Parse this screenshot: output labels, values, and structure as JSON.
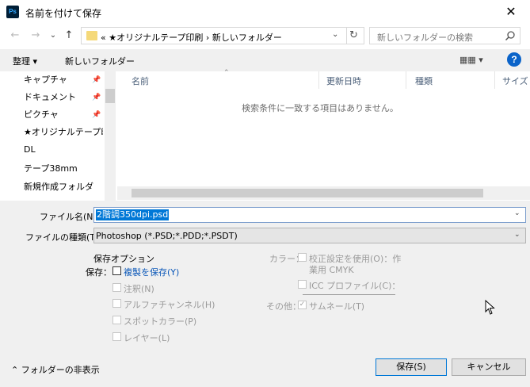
{
  "window": {
    "title": "名前を付けて保存",
    "app_icon": "Ps",
    "close_glyph": "✕"
  },
  "nav": {
    "back": "←",
    "forward": "→",
    "recent": "⌄",
    "up": "↑"
  },
  "address": {
    "path": "«  ★オリジナルテープ印刷  ›  新しいフォルダー",
    "dropdown": "⌄",
    "refresh": "↻"
  },
  "search": {
    "placeholder": "新しいフォルダーの検索"
  },
  "toolbar": {
    "organize": "整理 ▾",
    "new_folder": "新しいフォルダー",
    "view": "▦▦ ▾",
    "help": "?"
  },
  "sidebar": {
    "items": [
      {
        "label": "キャプチャ",
        "pinned": true,
        "icon": "folder-icon"
      },
      {
        "label": "ドキュメント",
        "pinned": true,
        "icon": "document-icon"
      },
      {
        "label": "ピクチャ",
        "pinned": true,
        "icon": "pictures-icon"
      },
      {
        "label": "★オリジナルテープ印",
        "pinned": false,
        "icon": "folder-icon"
      },
      {
        "label": "DL",
        "pinned": false,
        "icon": "folder-icon"
      },
      {
        "label": "テープ38mm",
        "pinned": false,
        "icon": "folder-icon"
      },
      {
        "label": "新規作成フォルダ",
        "pinned": false,
        "icon": "folder-icon"
      }
    ],
    "pin_glyph": "📌"
  },
  "file_list": {
    "columns": [
      "名前",
      "更新日時",
      "種類",
      "サイズ"
    ],
    "sort_glyph": "⌃",
    "empty_message": "検索条件に一致する項目はありません。"
  },
  "form": {
    "filename_label": "ファイル名(N):",
    "filename_value": "2階調350dpi.psd",
    "filetype_label": "ファイルの種類(T):",
    "filetype_value": "Photoshop (*.PSD;*.PDD;*.PSDT)",
    "dropdown": "⌄"
  },
  "options": {
    "heading": "保存オプション",
    "save_label": "保存：",
    "save_copy": "複製を保存(Y)",
    "notes": "注釈(N)",
    "alpha": "アルファチャンネル(H)",
    "spot": "スポットカラー(P)",
    "layers": "レイヤー(L)",
    "color_label": "カラー：",
    "proof_line1": "校正設定を使用(O)：作",
    "proof_line2": "業用 CMYK",
    "icc": "ICC プロファイル(C)：",
    "other_label": "その他：",
    "thumbnail": "サムネール(T)",
    "check_glyph": "✓"
  },
  "footer": {
    "toggle_folders": "フォルダーの非表示",
    "toggle_glyph": "⌃",
    "save_button": "保存(S)",
    "cancel_button": "キャンセル"
  }
}
